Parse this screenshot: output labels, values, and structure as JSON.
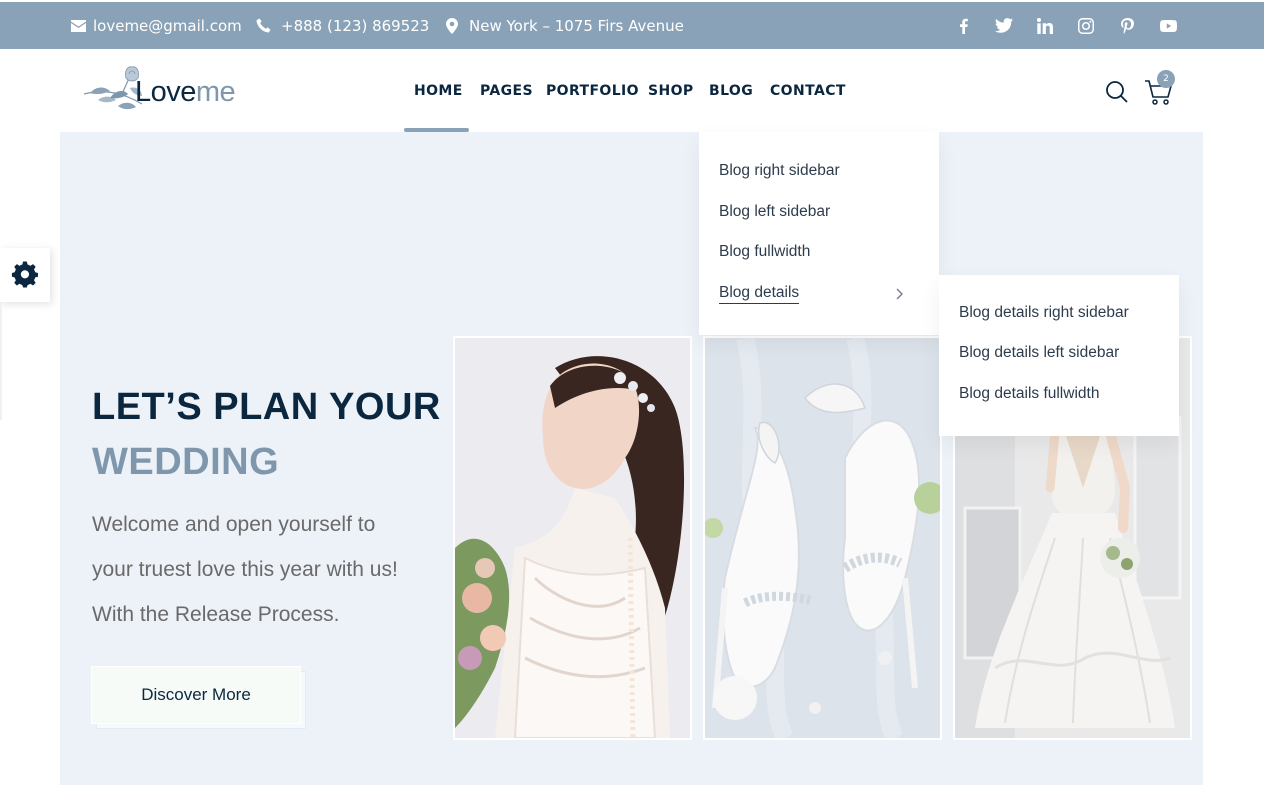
{
  "topbar": {
    "email": "loveme@gmail.com",
    "phone": "+888 (123) 869523",
    "address": "New York – 1075 Firs Avenue",
    "social_icons": [
      "facebook-icon",
      "twitter-icon",
      "linkedin-icon",
      "instagram-icon",
      "pinterest-icon",
      "youtube-icon"
    ]
  },
  "header": {
    "logo_part1": "Love",
    "logo_part2": "me",
    "nav": [
      "HOME",
      "PAGES",
      "PORTFOLIO",
      "SHOP",
      "BLOG",
      "CONTACT"
    ],
    "active_nav": "HOME",
    "cart_count": "2"
  },
  "hero": {
    "title_line1": "LET’S PLAN YOUR",
    "title_line2": "WEDDING",
    "description_lines": [
      "Welcome and open yourself to",
      "your truest love this year with us!",
      "With the Release Process."
    ],
    "button_label": "Discover More"
  },
  "blog_dropdown": {
    "items": [
      "Blog right sidebar",
      "Blog left sidebar",
      "Blog fullwidth",
      "Blog details"
    ],
    "active_item": "Blog details"
  },
  "blog_details_submenu": {
    "items": [
      "Blog details right sidebar",
      "Blog details left sidebar",
      "Blog details fullwidth"
    ]
  },
  "colors": {
    "accent": "#8aa2b7",
    "navy": "#0b2740",
    "hero_bg": "#edf1f8",
    "muted_blue": "#7e97ac"
  }
}
